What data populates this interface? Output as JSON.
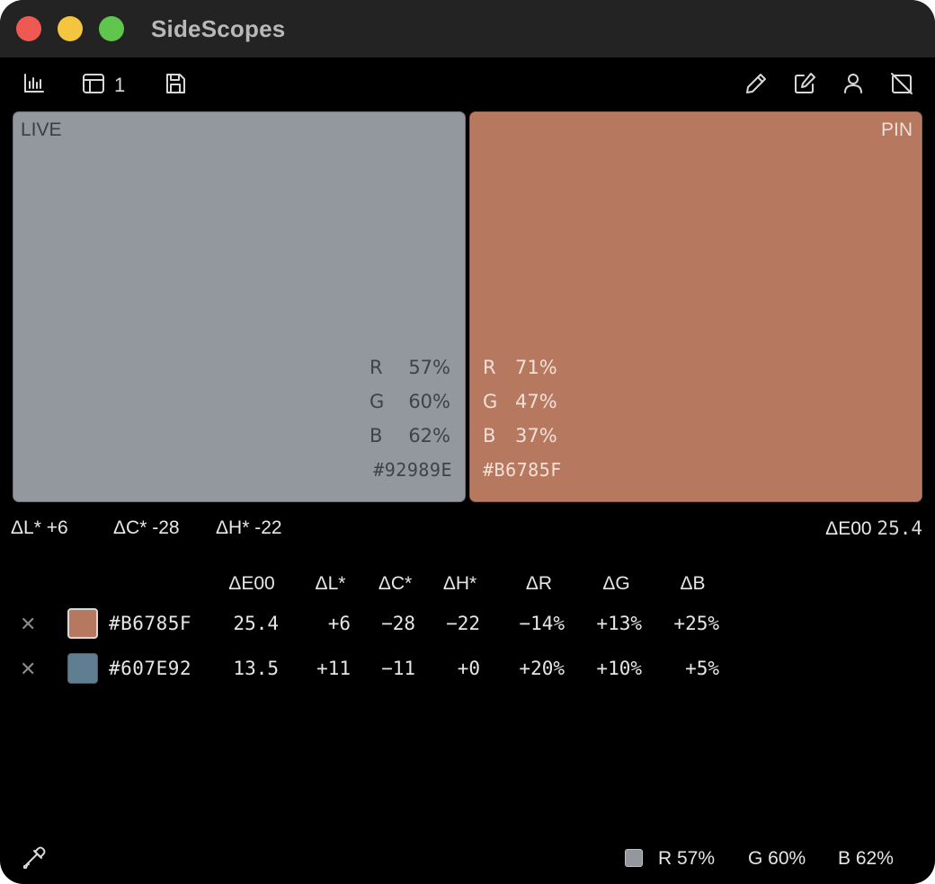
{
  "window": {
    "title": "SideScopes"
  },
  "toolbar": {
    "layout_count": "1",
    "icons": [
      "chart-icon",
      "layout-icon",
      "save-icon",
      "pencil-icon",
      "edit-icon",
      "person-icon",
      "no-frame-icon"
    ]
  },
  "live": {
    "label": "LIVE",
    "color": "#92989E",
    "r": "57%",
    "g": "60%",
    "b": "62%",
    "hex": "#92989E"
  },
  "pin": {
    "label": "PIN",
    "color": "#B6785F",
    "r": "71%",
    "g": "47%",
    "b": "37%",
    "hex": "#B6785F"
  },
  "channels": {
    "r": "R",
    "g": "G",
    "b": "B"
  },
  "delta": {
    "dl_label": "ΔL*",
    "dl_value": "+6",
    "dc_label": "ΔC*",
    "dc_value": "-28",
    "dh_label": "ΔH*",
    "dh_value": "-22",
    "de_label": "ΔE00",
    "de_value": "25.4"
  },
  "table": {
    "headers": [
      "ΔE00",
      "ΔL*",
      "ΔC*",
      "ΔH*",
      "ΔR",
      "ΔG",
      "ΔB"
    ],
    "remove_symbol": "✕",
    "rows": [
      {
        "color": "#B6785F",
        "hex": "#B6785F",
        "de": "25.4",
        "dl": "+6",
        "dc": "−28",
        "dh": "−22",
        "dr": "−14%",
        "dg": "+13%",
        "db": "+25%"
      },
      {
        "color": "#607E92",
        "hex": "#607E92",
        "de": "13.5",
        "dl": "+11",
        "dc": "−11",
        "dh": "+0",
        "dr": "+20%",
        "dg": "+10%",
        "db": "+5%"
      }
    ]
  },
  "status": {
    "swatch_color": "#92989E",
    "r": "R 57%",
    "g": "G 60%",
    "b": "B 62%",
    "icon": "eyedropper-icon"
  }
}
